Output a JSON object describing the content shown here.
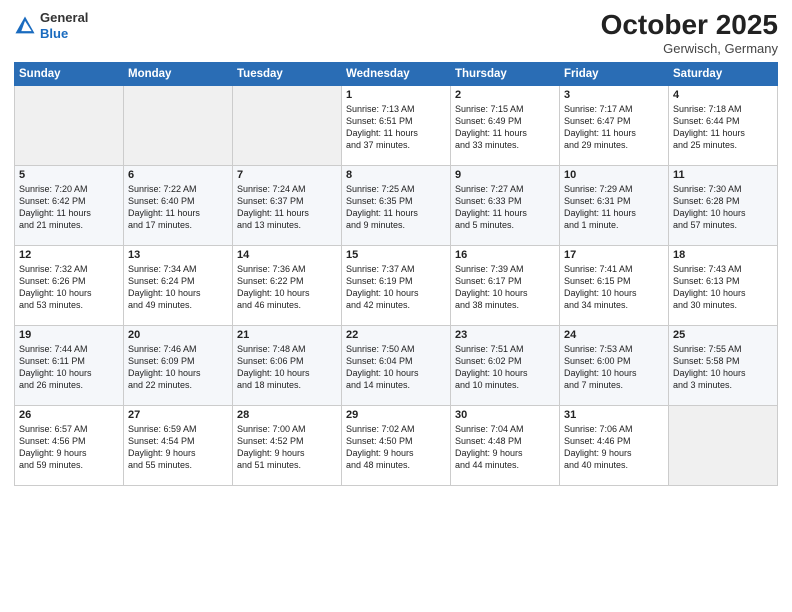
{
  "header": {
    "logo_line1": "General",
    "logo_line2": "Blue",
    "month": "October 2025",
    "location": "Gerwisch, Germany"
  },
  "weekdays": [
    "Sunday",
    "Monday",
    "Tuesday",
    "Wednesday",
    "Thursday",
    "Friday",
    "Saturday"
  ],
  "weeks": [
    [
      {
        "day": "",
        "empty": true
      },
      {
        "day": "",
        "empty": true
      },
      {
        "day": "",
        "empty": true
      },
      {
        "day": "1",
        "lines": [
          "Sunrise: 7:13 AM",
          "Sunset: 6:51 PM",
          "Daylight: 11 hours",
          "and 37 minutes."
        ]
      },
      {
        "day": "2",
        "lines": [
          "Sunrise: 7:15 AM",
          "Sunset: 6:49 PM",
          "Daylight: 11 hours",
          "and 33 minutes."
        ]
      },
      {
        "day": "3",
        "lines": [
          "Sunrise: 7:17 AM",
          "Sunset: 6:47 PM",
          "Daylight: 11 hours",
          "and 29 minutes."
        ]
      },
      {
        "day": "4",
        "lines": [
          "Sunrise: 7:18 AM",
          "Sunset: 6:44 PM",
          "Daylight: 11 hours",
          "and 25 minutes."
        ]
      }
    ],
    [
      {
        "day": "5",
        "lines": [
          "Sunrise: 7:20 AM",
          "Sunset: 6:42 PM",
          "Daylight: 11 hours",
          "and 21 minutes."
        ]
      },
      {
        "day": "6",
        "lines": [
          "Sunrise: 7:22 AM",
          "Sunset: 6:40 PM",
          "Daylight: 11 hours",
          "and 17 minutes."
        ]
      },
      {
        "day": "7",
        "lines": [
          "Sunrise: 7:24 AM",
          "Sunset: 6:37 PM",
          "Daylight: 11 hours",
          "and 13 minutes."
        ]
      },
      {
        "day": "8",
        "lines": [
          "Sunrise: 7:25 AM",
          "Sunset: 6:35 PM",
          "Daylight: 11 hours",
          "and 9 minutes."
        ]
      },
      {
        "day": "9",
        "lines": [
          "Sunrise: 7:27 AM",
          "Sunset: 6:33 PM",
          "Daylight: 11 hours",
          "and 5 minutes."
        ]
      },
      {
        "day": "10",
        "lines": [
          "Sunrise: 7:29 AM",
          "Sunset: 6:31 PM",
          "Daylight: 11 hours",
          "and 1 minute."
        ]
      },
      {
        "day": "11",
        "lines": [
          "Sunrise: 7:30 AM",
          "Sunset: 6:28 PM",
          "Daylight: 10 hours",
          "and 57 minutes."
        ]
      }
    ],
    [
      {
        "day": "12",
        "lines": [
          "Sunrise: 7:32 AM",
          "Sunset: 6:26 PM",
          "Daylight: 10 hours",
          "and 53 minutes."
        ]
      },
      {
        "day": "13",
        "lines": [
          "Sunrise: 7:34 AM",
          "Sunset: 6:24 PM",
          "Daylight: 10 hours",
          "and 49 minutes."
        ]
      },
      {
        "day": "14",
        "lines": [
          "Sunrise: 7:36 AM",
          "Sunset: 6:22 PM",
          "Daylight: 10 hours",
          "and 46 minutes."
        ]
      },
      {
        "day": "15",
        "lines": [
          "Sunrise: 7:37 AM",
          "Sunset: 6:19 PM",
          "Daylight: 10 hours",
          "and 42 minutes."
        ]
      },
      {
        "day": "16",
        "lines": [
          "Sunrise: 7:39 AM",
          "Sunset: 6:17 PM",
          "Daylight: 10 hours",
          "and 38 minutes."
        ]
      },
      {
        "day": "17",
        "lines": [
          "Sunrise: 7:41 AM",
          "Sunset: 6:15 PM",
          "Daylight: 10 hours",
          "and 34 minutes."
        ]
      },
      {
        "day": "18",
        "lines": [
          "Sunrise: 7:43 AM",
          "Sunset: 6:13 PM",
          "Daylight: 10 hours",
          "and 30 minutes."
        ]
      }
    ],
    [
      {
        "day": "19",
        "lines": [
          "Sunrise: 7:44 AM",
          "Sunset: 6:11 PM",
          "Daylight: 10 hours",
          "and 26 minutes."
        ]
      },
      {
        "day": "20",
        "lines": [
          "Sunrise: 7:46 AM",
          "Sunset: 6:09 PM",
          "Daylight: 10 hours",
          "and 22 minutes."
        ]
      },
      {
        "day": "21",
        "lines": [
          "Sunrise: 7:48 AM",
          "Sunset: 6:06 PM",
          "Daylight: 10 hours",
          "and 18 minutes."
        ]
      },
      {
        "day": "22",
        "lines": [
          "Sunrise: 7:50 AM",
          "Sunset: 6:04 PM",
          "Daylight: 10 hours",
          "and 14 minutes."
        ]
      },
      {
        "day": "23",
        "lines": [
          "Sunrise: 7:51 AM",
          "Sunset: 6:02 PM",
          "Daylight: 10 hours",
          "and 10 minutes."
        ]
      },
      {
        "day": "24",
        "lines": [
          "Sunrise: 7:53 AM",
          "Sunset: 6:00 PM",
          "Daylight: 10 hours",
          "and 7 minutes."
        ]
      },
      {
        "day": "25",
        "lines": [
          "Sunrise: 7:55 AM",
          "Sunset: 5:58 PM",
          "Daylight: 10 hours",
          "and 3 minutes."
        ]
      }
    ],
    [
      {
        "day": "26",
        "lines": [
          "Sunrise: 6:57 AM",
          "Sunset: 4:56 PM",
          "Daylight: 9 hours",
          "and 59 minutes."
        ]
      },
      {
        "day": "27",
        "lines": [
          "Sunrise: 6:59 AM",
          "Sunset: 4:54 PM",
          "Daylight: 9 hours",
          "and 55 minutes."
        ]
      },
      {
        "day": "28",
        "lines": [
          "Sunrise: 7:00 AM",
          "Sunset: 4:52 PM",
          "Daylight: 9 hours",
          "and 51 minutes."
        ]
      },
      {
        "day": "29",
        "lines": [
          "Sunrise: 7:02 AM",
          "Sunset: 4:50 PM",
          "Daylight: 9 hours",
          "and 48 minutes."
        ]
      },
      {
        "day": "30",
        "lines": [
          "Sunrise: 7:04 AM",
          "Sunset: 4:48 PM",
          "Daylight: 9 hours",
          "and 44 minutes."
        ]
      },
      {
        "day": "31",
        "lines": [
          "Sunrise: 7:06 AM",
          "Sunset: 4:46 PM",
          "Daylight: 9 hours",
          "and 40 minutes."
        ]
      },
      {
        "day": "",
        "empty": true
      }
    ]
  ]
}
